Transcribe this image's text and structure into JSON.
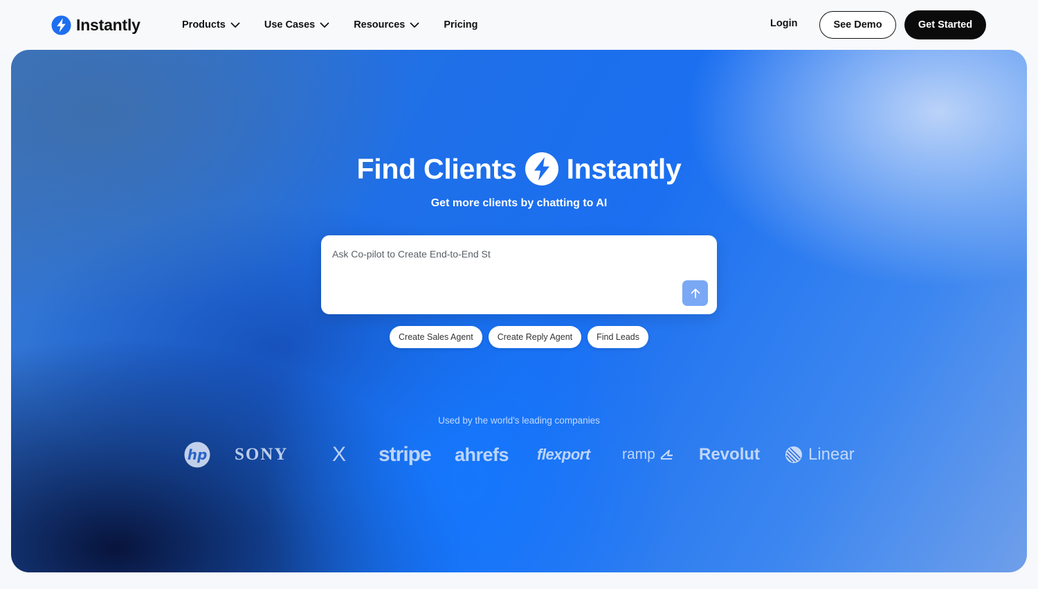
{
  "brand": {
    "name": "Instantly",
    "accent": "#1e6ff0"
  },
  "nav": {
    "menu": [
      {
        "label": "Products",
        "has_dropdown": true
      },
      {
        "label": "Use Cases",
        "has_dropdown": true
      },
      {
        "label": "Resources",
        "has_dropdown": true
      },
      {
        "label": "Pricing",
        "has_dropdown": false
      }
    ],
    "login": "Login",
    "see_demo": "See Demo",
    "get_started": "Get Started"
  },
  "hero": {
    "title_left": "Find Clients",
    "title_right": "Instantly",
    "subtitle": "Get more clients by chatting to AI",
    "prompt_placeholder": "Ask Co-pilot to Create End-to-End St",
    "chips": [
      "Create Sales Agent",
      "Create Reply Agent",
      "Find Leads"
    ],
    "trusted_text": "Used by the world's leading companies",
    "logos": {
      "hp": "hp",
      "sony": "SONY",
      "x": "X",
      "stripe": "stripe",
      "ahrefs": "ahrefs",
      "flexport": "flexport",
      "ramp": "ramp",
      "revolut": "Revolut",
      "linear": "Linear"
    }
  },
  "icons": {
    "brand_logo": "lightning-bolt-icon",
    "dropdown": "chevron-down-icon",
    "send": "arrow-up-icon"
  }
}
